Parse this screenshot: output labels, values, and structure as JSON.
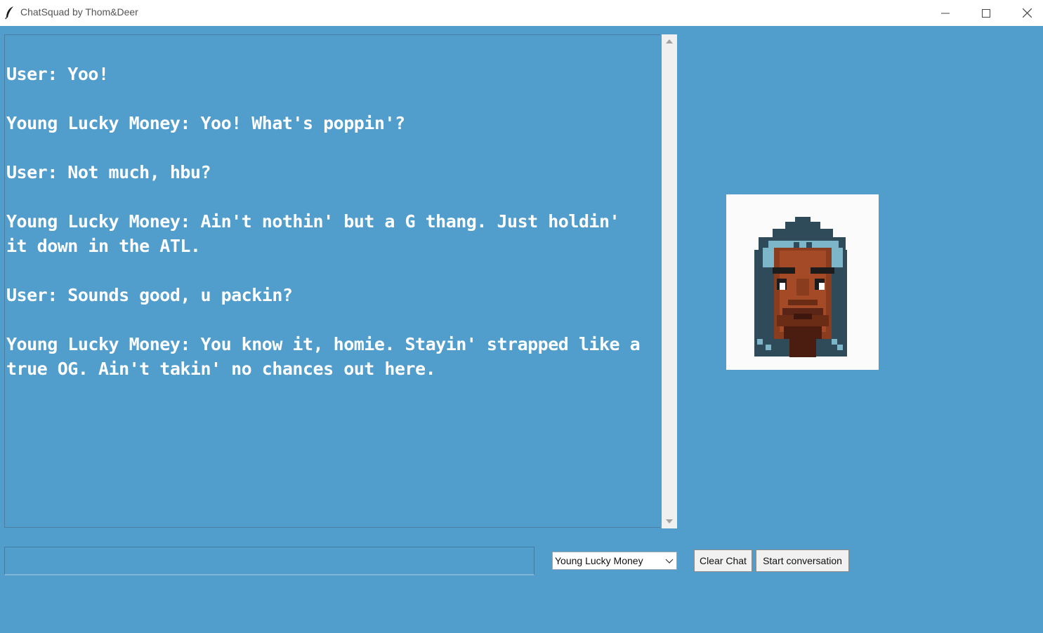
{
  "window": {
    "title": "ChatSquad by Thom&Deer",
    "icon": "feather-icon"
  },
  "chat": {
    "messages": [
      {
        "text": "User: Yoo!"
      },
      {
        "text": "Young Lucky Money: Yoo! What's poppin'?"
      },
      {
        "text": "User: Not much, hbu?"
      },
      {
        "text": "Young Lucky Money: Ain't nothin' but a G thang. Just holdin'\nit down in the ATL."
      },
      {
        "text": "User: Sounds good, u packin?"
      },
      {
        "text": "Young Lucky Money: You know it, homie. Stayin' strapped like a\ntrue OG. Ain't takin' no chances out here."
      }
    ]
  },
  "input": {
    "value": "",
    "placeholder": ""
  },
  "character_select": {
    "selected": "Young Lucky Money"
  },
  "buttons": {
    "clear": "Clear Chat",
    "start": "Start conversation"
  },
  "colors": {
    "background": "#519dcc",
    "text": "#ffffff"
  }
}
